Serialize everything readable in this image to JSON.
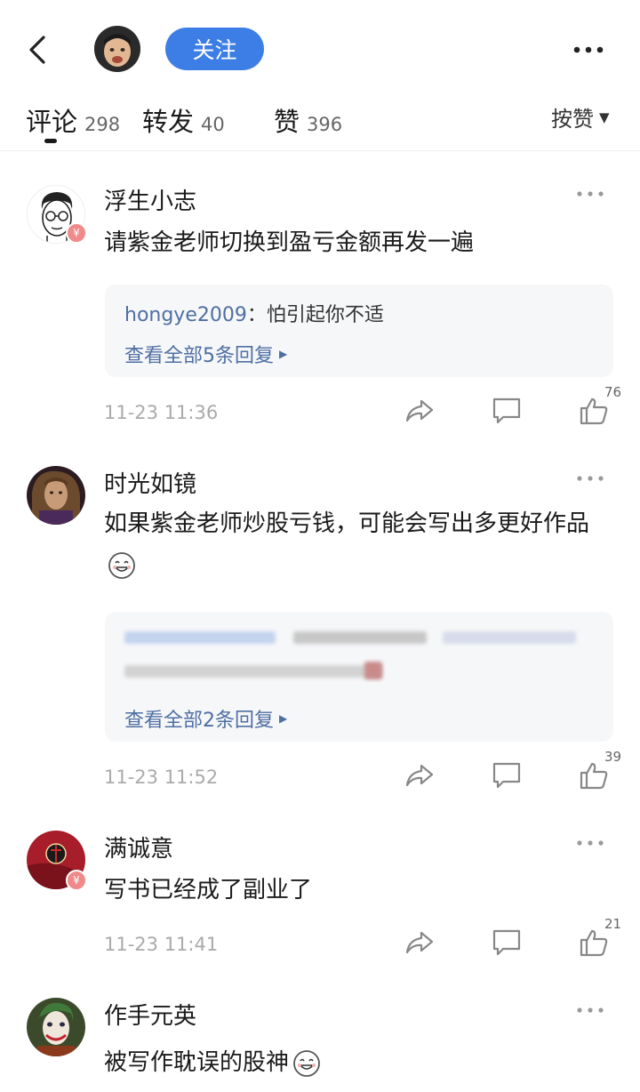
{
  "header": {
    "follow_label": "关注",
    "icons": {
      "back": "chevron-left-icon",
      "more": "more-horizontal-icon"
    }
  },
  "tabs": {
    "comments": {
      "label": "评论",
      "count": "298"
    },
    "reposts": {
      "label": "转发",
      "count": "40"
    },
    "likes": {
      "label": "赞",
      "count": "396"
    },
    "sort_label": "按赞"
  },
  "colors": {
    "accent": "#3d7ee6",
    "link": "#4f6fa3",
    "muted": "#aaaaaa",
    "reply_bg": "#f6f7f9",
    "badge": "#f08a8a"
  },
  "comments": [
    {
      "username": "浮生小志",
      "text": "请紫金老师切换到盈亏金额再发一遍",
      "reply_author": "hongye2009",
      "reply_text": "：怕引起你不适",
      "view_all": "查看全部5条回复",
      "time": "11-23 11:36",
      "likes": "76"
    },
    {
      "username": "时光如镜",
      "text": "如果紫金老师炒股亏钱，可能会写出多更好作品",
      "view_all": "查看全部2条回复",
      "time": "11-23 11:52",
      "likes": "39"
    },
    {
      "username": "满诚意",
      "text": "写书已经成了副业了",
      "time": "11-23 11:41",
      "likes": "21"
    },
    {
      "username": "作手元英",
      "text": "被写作耽误的股神"
    }
  ]
}
